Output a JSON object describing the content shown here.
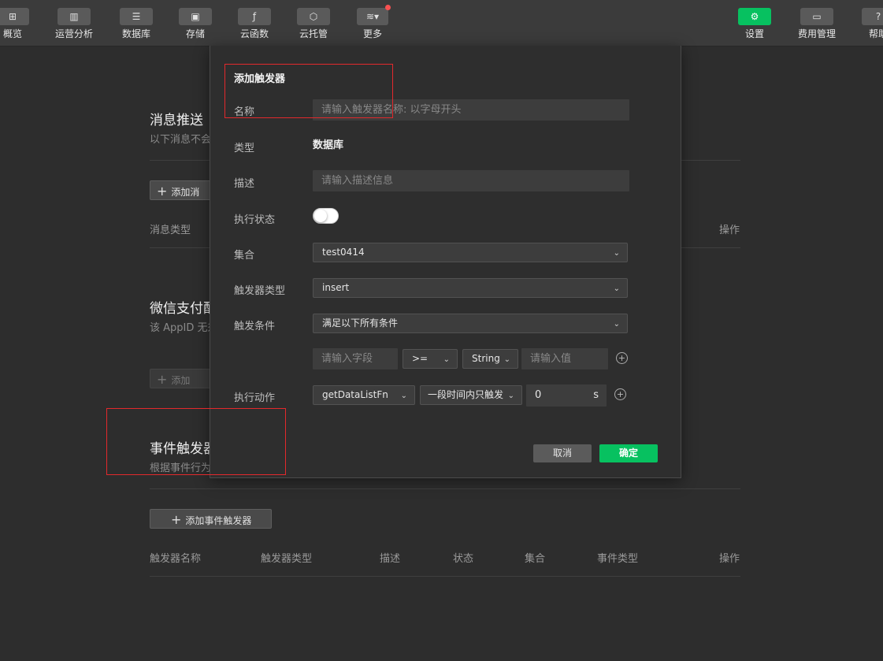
{
  "toolbar": {
    "left": [
      {
        "label": "概览",
        "icon": "⊞"
      },
      {
        "label": "运营分析",
        "icon": "▥"
      },
      {
        "label": "数据库",
        "icon": "☰"
      },
      {
        "label": "存储",
        "icon": "▣"
      },
      {
        "label": "云函数",
        "icon": "ƒ"
      },
      {
        "label": "云托管",
        "icon": "⬡"
      },
      {
        "label": "更多",
        "icon": "≋▾"
      }
    ],
    "right": [
      {
        "label": "设置",
        "icon": "⚙"
      },
      {
        "label": "费用管理",
        "icon": "▭"
      },
      {
        "label": "帮助",
        "icon": "?"
      }
    ]
  },
  "sections": {
    "push": {
      "title": "消息推送",
      "subtitle": "以下消息不会",
      "add_label": "添加消",
      "th_type": "消息类型",
      "th_op": "操作"
    },
    "pay": {
      "title": "微信支付配",
      "subtitle": "该 AppID 无须",
      "add_label": "添加"
    },
    "trigger": {
      "title": "事件触发器",
      "subtitle": "根据事件行为",
      "add_label": "添加事件触发器",
      "headers": [
        "触发器名称",
        "触发器类型",
        "描述",
        "状态",
        "集合",
        "事件类型",
        "操作"
      ]
    }
  },
  "dialog": {
    "title": "添加触发器",
    "name_label": "名称",
    "name_placeholder": "请输入触发器名称: 以字母开头",
    "type_label": "类型",
    "type_value": "数据库",
    "desc_label": "描述",
    "desc_placeholder": "请输入描述信息",
    "status_label": "执行状态",
    "status_on": false,
    "collection_label": "集合",
    "collection_value": "test0414",
    "trigger_type_label": "触发器类型",
    "trigger_type_value": "insert",
    "condition_label": "触发条件",
    "condition_value": "满足以下所有条件",
    "field_placeholder": "请输入字段",
    "operator_value": ">=",
    "value_type": "String",
    "value_placeholder": "请输入值",
    "action_label": "执行动作",
    "action_function": "getDataListFn",
    "action_mode": "一段时间内只触发",
    "action_interval": "0",
    "action_unit": "s",
    "cancel_label": "取消",
    "ok_label": "确定"
  },
  "colors": {
    "accent": "#07c160",
    "highlight": "#e3292c"
  }
}
